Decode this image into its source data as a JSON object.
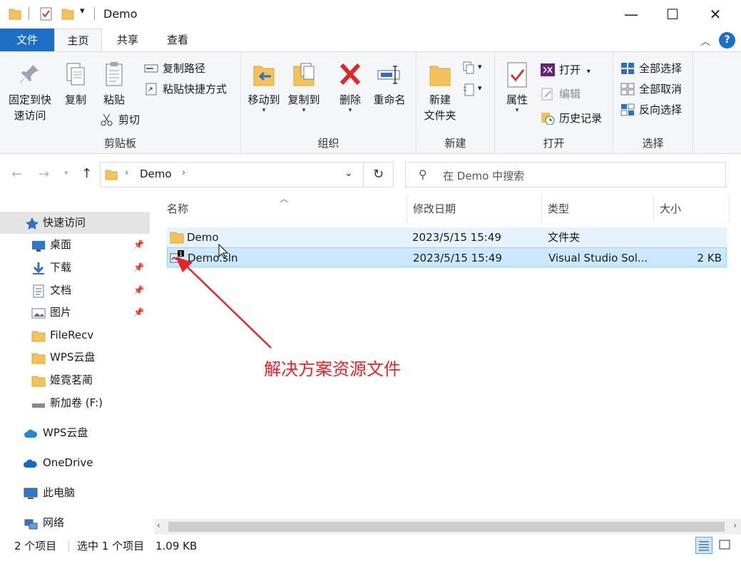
{
  "window": {
    "title": "Demo",
    "minimize_glyph": "—",
    "maximize_glyph": "☐",
    "close_glyph": "✕"
  },
  "tabs": {
    "file": "文件",
    "home": "主页",
    "share": "共享",
    "view": "查看"
  },
  "ribbon": {
    "clipboard": {
      "label": "剪贴板",
      "pin": "固定到快速访问",
      "pin_line1": "固定到快",
      "pin_line2": "速访问",
      "copy": "复制",
      "paste": "粘贴",
      "copy_path": "复制路径",
      "paste_shortcut": "粘贴快捷方式",
      "cut": "剪切"
    },
    "organize": {
      "label": "组织",
      "move_to": "移动到",
      "copy_to": "复制到",
      "delete": "删除",
      "rename": "重命名"
    },
    "new": {
      "label": "新建",
      "new_folder_line1": "新建",
      "new_folder_line2": "文件夹"
    },
    "open": {
      "label": "打开",
      "properties": "属性",
      "open": "打开",
      "edit": "编辑",
      "history": "历史记录"
    },
    "select": {
      "label": "选择",
      "select_all": "全部选择",
      "select_none": "全部取消",
      "invert": "反向选择"
    }
  },
  "address": {
    "path": "Demo",
    "search_placeholder": "在 Demo 中搜索"
  },
  "nav": {
    "quick_access": "快速访问",
    "items": [
      {
        "label": "桌面",
        "pinned": true
      },
      {
        "label": "下载",
        "pinned": true
      },
      {
        "label": "文档",
        "pinned": true
      },
      {
        "label": "图片",
        "pinned": true
      },
      {
        "label": "FileRecv",
        "pinned": false
      },
      {
        "label": "WPS云盘",
        "pinned": false
      },
      {
        "label": "姬霓茗蔺",
        "pinned": false
      },
      {
        "label": "新加卷 (F:)",
        "pinned": false
      }
    ],
    "wps_cloud": "WPS云盘",
    "onedrive": "OneDrive",
    "this_pc": "此电脑",
    "network": "网络"
  },
  "columns": {
    "name": "名称",
    "modified": "修改日期",
    "type": "类型",
    "size": "大小"
  },
  "files": [
    {
      "name": "Demo",
      "modified": "2023/5/15 15:49",
      "type": "文件夹",
      "size": ""
    },
    {
      "name": "Demo.sln",
      "modified": "2023/5/15 15:49",
      "type": "Visual Studio Sol...",
      "size": "2 KB"
    }
  ],
  "status": {
    "count": "2 个项目",
    "selected": "选中 1 个项目",
    "selected_size": "1.09 KB"
  },
  "annotation": {
    "text": "解决方案资源文件",
    "color": "#e8232a"
  },
  "colors": {
    "accent": "#1d6fc5",
    "selection": "#cce8ff",
    "folder": "#f4c25b"
  }
}
